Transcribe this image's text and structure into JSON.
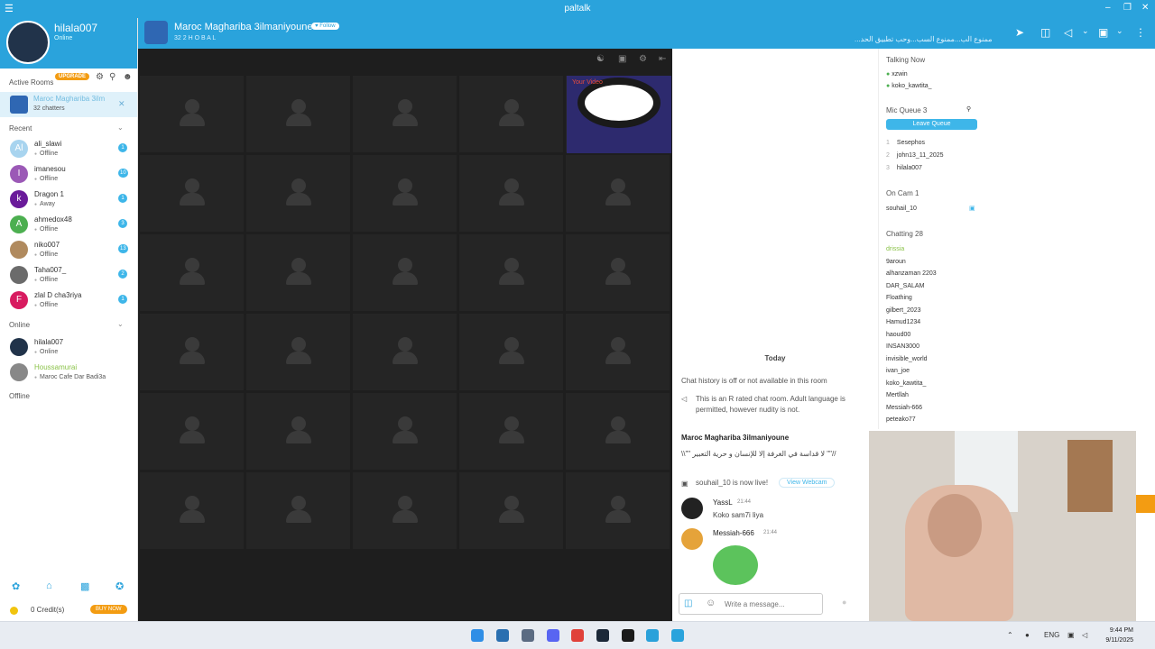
{
  "app": {
    "brand": "paltalk"
  },
  "profile": {
    "username": "hilala007",
    "status": "Online",
    "upgrade": "UPGRADE"
  },
  "sidebar": {
    "active_rooms_header": "Active Rooms",
    "recent_header": "Recent",
    "online_header": "Online",
    "offline_header": "Offline",
    "active_room": {
      "name": "Maroc Maghariba 3ilm",
      "count": "32 chatters"
    },
    "recent": [
      {
        "name": "ali_slawi",
        "status": "Offline",
        "badge": "1",
        "initial": "Al",
        "color": "#a8d4ef"
      },
      {
        "name": "imanesou",
        "status": "Offline",
        "badge": "10",
        "initial": "I",
        "color": "#9b59b6"
      },
      {
        "name": "Dragon 1",
        "status": "Away",
        "badge": "1",
        "initial": "k",
        "color": "#6a1b9a"
      },
      {
        "name": "ahmedox48",
        "status": "Offline",
        "badge": "3",
        "initial": "A",
        "color": "#4caf50"
      },
      {
        "name": "niko007",
        "status": "Offline",
        "badge": "13",
        "initial": "",
        "color": "#b08a5e"
      },
      {
        "name": "Taha007_",
        "status": "Offline",
        "badge": "2",
        "initial": "",
        "color": "#6b6b6b"
      },
      {
        "name": "zlal D cha3riya",
        "status": "Offline",
        "badge": "1",
        "initial": "F",
        "color": "#d81b60"
      }
    ],
    "online": [
      {
        "name": "hilala007",
        "status": "Online"
      },
      {
        "name": "Houssamurai",
        "status": "Maroc Cafe Dar Badi3a"
      }
    ],
    "credits": "0 Credit(s)",
    "buy": "BUY NOW"
  },
  "room": {
    "title": "Maroc Maghariba 3ilmaniyoune",
    "follow": "Follow",
    "stats": "32  2  H O B A L",
    "marquee": "...ممنوع الب...ممنوع السب...وحب تطبيق الحد"
  },
  "video": {
    "your_video": "Your Video"
  },
  "chat": {
    "today": "Today",
    "history_off": "Chat history is off or not available in this room",
    "rated": "This is an R rated chat room. Adult language is permitted, however nudity is not.",
    "room_name": "Maroc Maghariba 3ilmaniyoune",
    "room_msg": "\\\\\"\" لا قداسة في الغرفة إلا للإنسان و حرية التعبير \"\"//",
    "live_text": "souhail_10 is now live!",
    "view_webcam": "View Webcam",
    "messages": [
      {
        "user": "YassL",
        "time": "21:44",
        "text": "Koko sam7i liya"
      },
      {
        "user": "Messiah-666",
        "time": "21:44",
        "text": ""
      }
    ],
    "placeholder": "Write a message..."
  },
  "userlist": {
    "talking_header": "Talking Now",
    "talking": [
      "xzwin",
      "koko_kawtita_"
    ],
    "mic_queue_header": "Mic Queue",
    "mic_queue_count": "3",
    "leave_queue": "Leave Queue",
    "queue": [
      {
        "n": "1",
        "name": "Sesephos"
      },
      {
        "n": "2",
        "name": "john13_11_2025"
      },
      {
        "n": "3",
        "name": "hilala007"
      }
    ],
    "on_cam_header": "On Cam",
    "on_cam_count": "1",
    "on_cam": [
      "souhail_10"
    ],
    "chatting_header": "Chatting",
    "chatting_count": "28",
    "chatting": [
      "drissia",
      "9aroun",
      "alhanzaman 2203",
      "DAR_SALAM",
      "Floathing",
      "gilbert_2023",
      "Hamud1234",
      "haoud00",
      "INSAN3000",
      "invisible_world",
      "ivan_joe",
      "koko_kawtita_",
      "Mertllah",
      "Messiah-666",
      "peteako77"
    ]
  },
  "taskbar": {
    "lang": "ENG",
    "time": "9:44 PM",
    "date": "9/11/2025"
  }
}
